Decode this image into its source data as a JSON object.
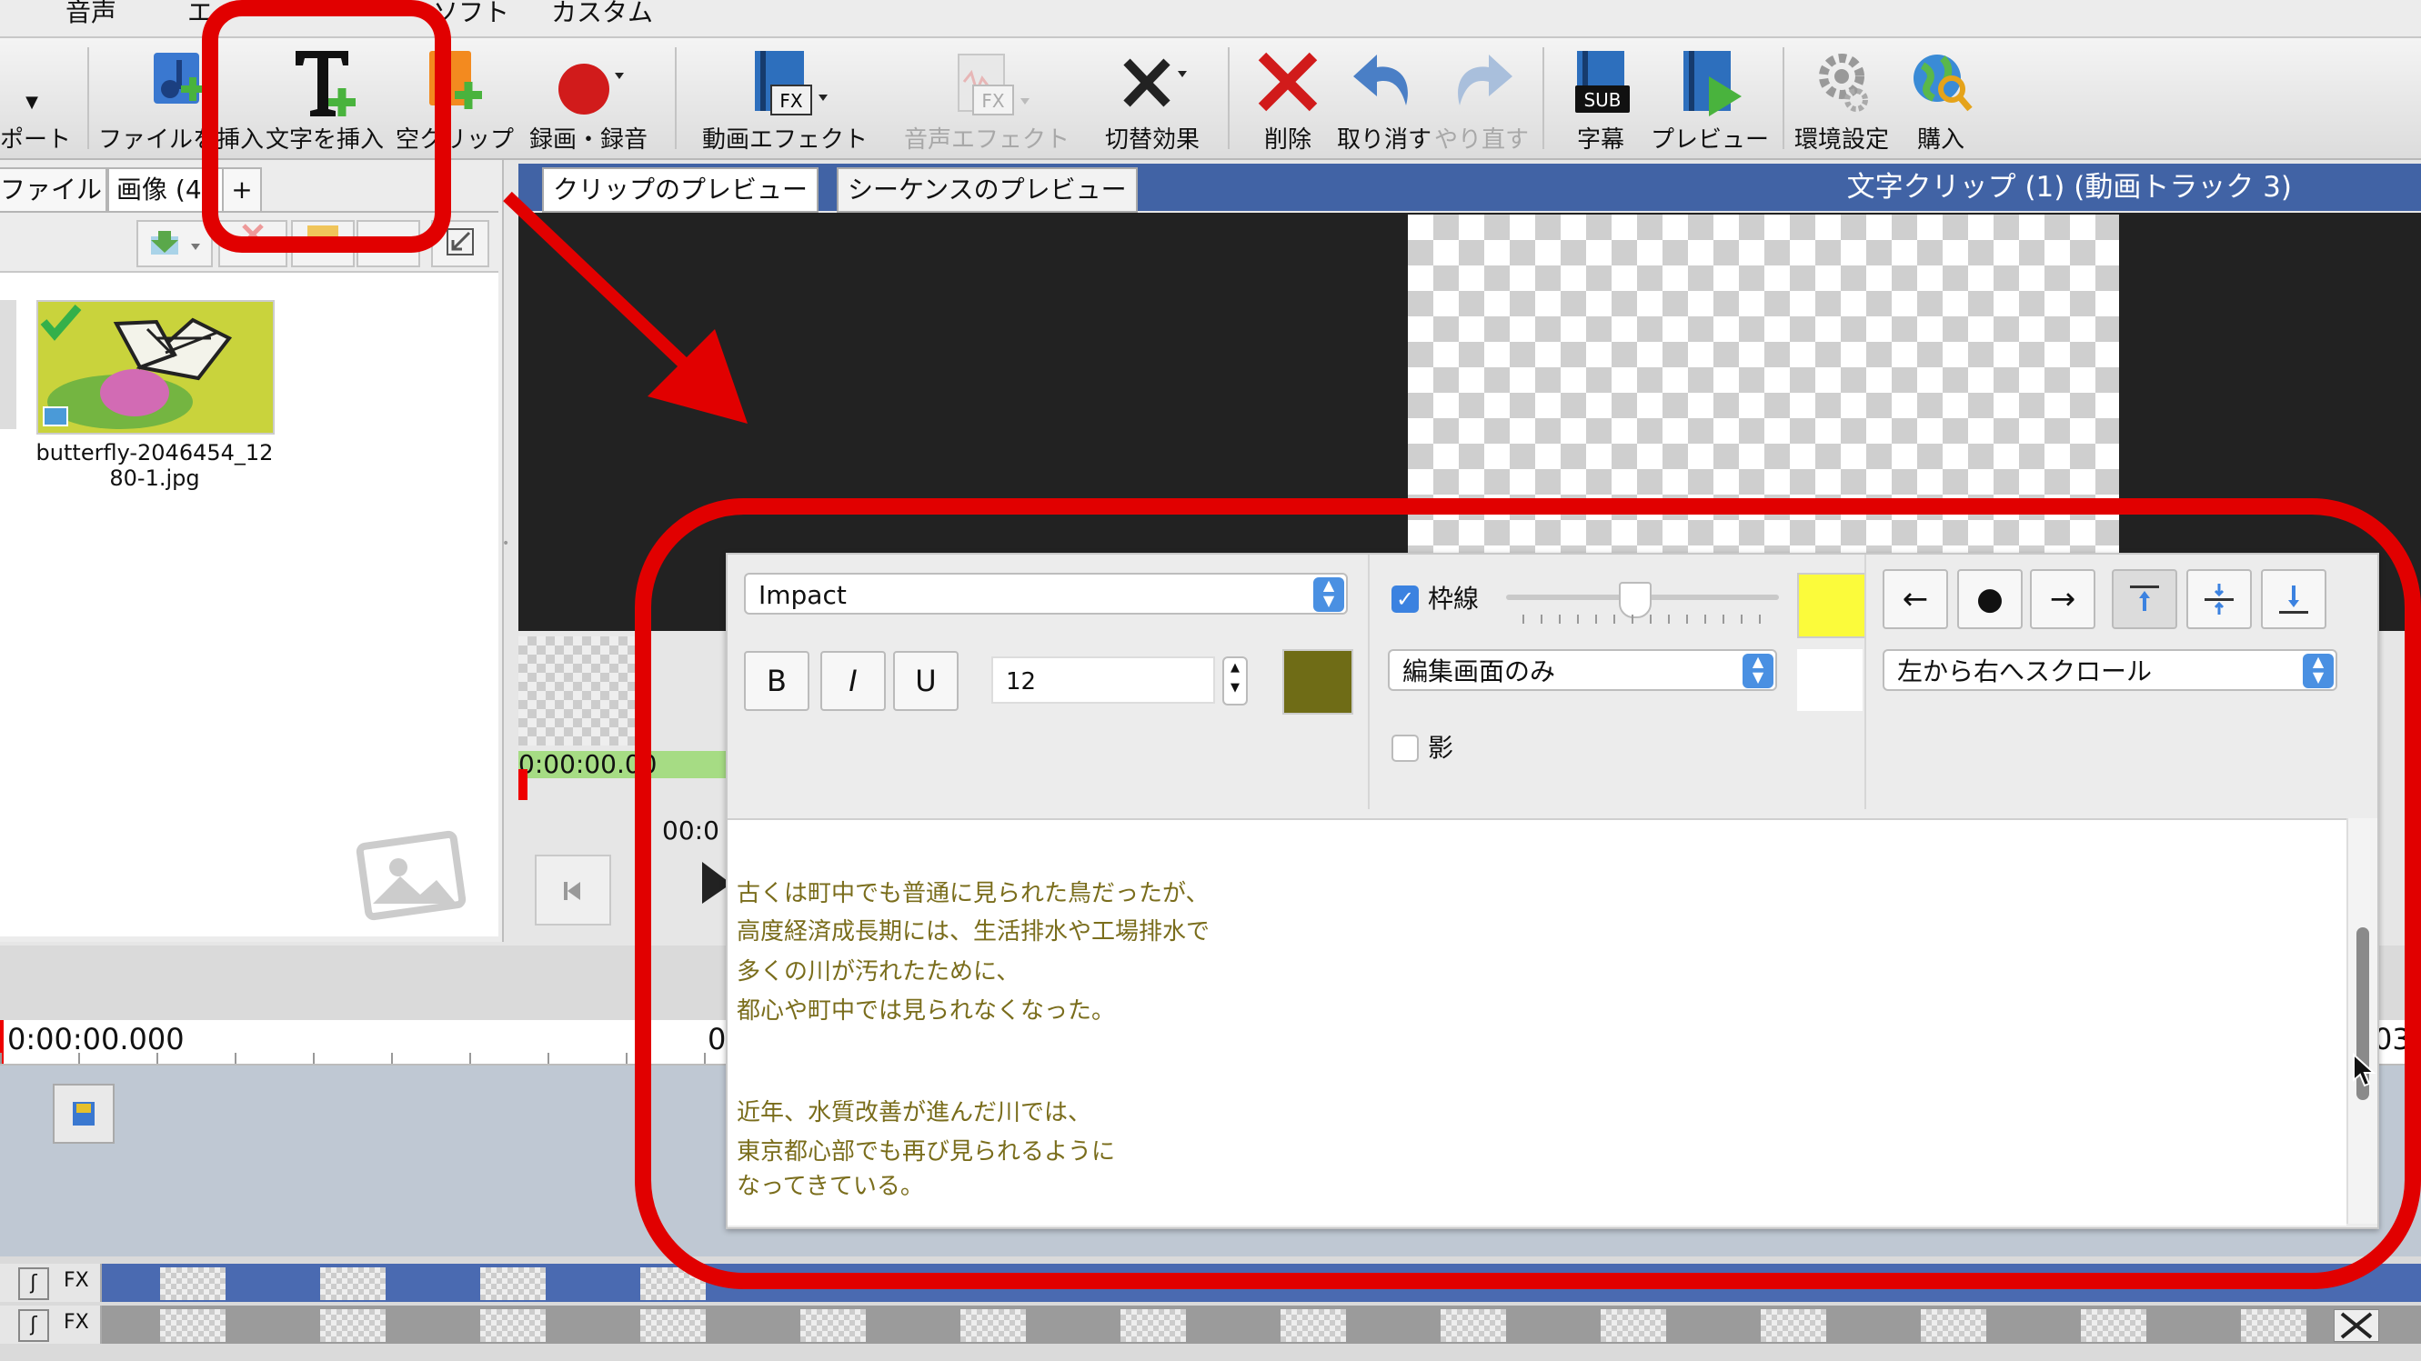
{
  "menu": {
    "items": [
      "音声",
      "エ",
      "ソフト",
      "カスタム"
    ]
  },
  "toolbar": {
    "import_label": "ポート",
    "file_insert_label": "ファイルを挿入",
    "text_insert_label": "文字を挿入",
    "empty_clip_label": "空クリップ",
    "record_label": "録画・録音",
    "video_effect_label": "動画エフェクト",
    "audio_effect_label": "音声エフェクト",
    "transition_label": "切替効果",
    "delete_label": "削除",
    "undo_label": "取り消す",
    "redo_label": "やり直す",
    "subtitle_label": "字幕",
    "preview_label": "プレビュー",
    "settings_label": "環境設定",
    "purchase_label": "購入",
    "fx_badge": "FX",
    "sub_badge": "SUB"
  },
  "media_panel": {
    "tabs": [
      "ファイル",
      "画像 (4"
    ],
    "add_tab_label": "+",
    "thumbnail_name_line1": "butterfly-2046454_12",
    "thumbnail_name_line2": "80-1.jpg"
  },
  "preview": {
    "tab_clip": "クリップのプレビュー",
    "tab_sequence": "シーケンスのプレビュー",
    "clip_title": "文字クリップ (1) (動画トラック 3)",
    "clip_timecode": "0:00:00.00",
    "seq_timecode_partial": "00:0"
  },
  "timeline": {
    "start_time": "0:00:00.000",
    "mid_partial": "0",
    "end_partial": "03",
    "fx_label": "FX"
  },
  "text_editor": {
    "font": "Impact",
    "bold_label": "B",
    "italic_label": "I",
    "underline_label": "U",
    "font_size": "12",
    "text_color": "#6f6c16",
    "outline_checked": true,
    "outline_label": "枠線",
    "outline_color": "#fbfb3b",
    "display_mode": "編集画面のみ",
    "shadow_checked": false,
    "shadow_label": "影",
    "scroll_mode": "左から右へスクロール",
    "body_lines": [
      "古くは町中でも普通に見られた鳥だったが、",
      "高度経済成長期には、生活排水や工場排水で",
      "多くの川が汚れたために、",
      "都心や町中では見られなくなった。",
      "近年、水質改善が進んだ川では、",
      "東京都心部でも再び見られるように",
      "なってきている。"
    ]
  },
  "colors": {
    "annotation_red": "#e10000",
    "header_blue": "#4163a5",
    "text_olive": "#7a6d1c"
  }
}
